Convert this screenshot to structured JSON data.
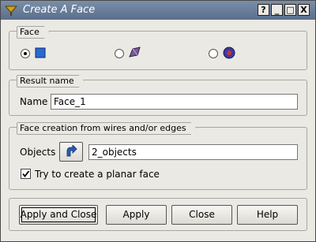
{
  "window": {
    "title": "Create A Face",
    "controls": {
      "help": "?",
      "minimize": "_",
      "maximize": "□",
      "close": "X"
    }
  },
  "face_group": {
    "title": "Face",
    "options": [
      {
        "icon": "blue-square-face-icon",
        "selected": true
      },
      {
        "icon": "shell-face-icon",
        "selected": false
      },
      {
        "icon": "spherical-face-icon",
        "selected": false
      }
    ]
  },
  "result_group": {
    "title": "Result name",
    "name_label": "Name",
    "name_value": "Face_1"
  },
  "creation_group": {
    "title": "Face creation from wires and/or edges",
    "objects_label": "Objects",
    "objects_value": "2_objects",
    "planar_label": "Try to create a planar face",
    "planar_checked": true
  },
  "buttons": {
    "apply_close": "Apply and Close",
    "apply": "Apply",
    "close": "Close",
    "help": "Help"
  }
}
